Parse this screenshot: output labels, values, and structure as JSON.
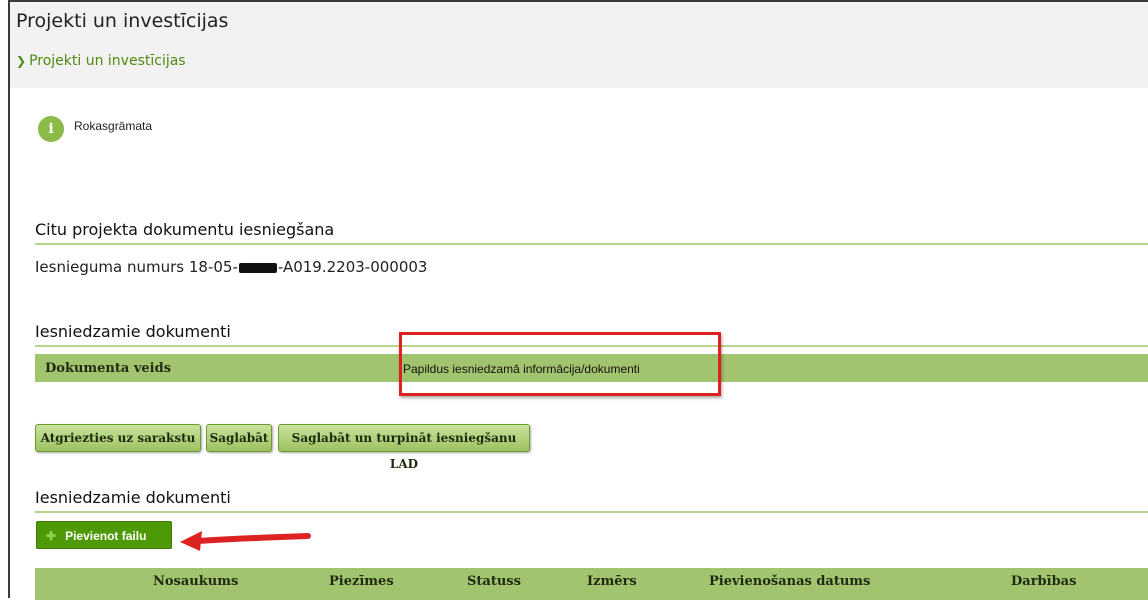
{
  "window": {
    "title": "Projekti un investīcijas"
  },
  "breadcrumb": {
    "label": "Projekti un investīcijas",
    "icon": "chevron-down-icon"
  },
  "help": {
    "icon": "info-icon",
    "icon_glyph": "i",
    "label": "Rokasgrāmata"
  },
  "submission": {
    "title": "Citu projekta dokumentu iesniegšana",
    "number_prefix": "Iesnieguma numurs 18-05-",
    "number_suffix": "-A019.2203-000003"
  },
  "documents": {
    "title": "Iesniedzamie dokumenti",
    "type_label": "Dokumenta veids",
    "type_value": "Papildus iesniedzamā informācija/dokumenti"
  },
  "actions": {
    "back": "Atgriezties uz sarakstu",
    "save": "Saglabāt",
    "save_continue": "Saglabāt un turpināt iesniegšanu LAD"
  },
  "files": {
    "title": "Iesniedzamie dokumenti",
    "add_label": "Pievienot failu",
    "add_icon": "plus-icon",
    "columns": [
      "Nosaukums",
      "Piezīmes",
      "Statuss",
      "Izmērs",
      "Pievienošanas datums",
      "Darbības"
    ]
  },
  "colors": {
    "accent": "#4e9a06",
    "table_header": "#a3c46e",
    "highlight": "#dd2222"
  }
}
